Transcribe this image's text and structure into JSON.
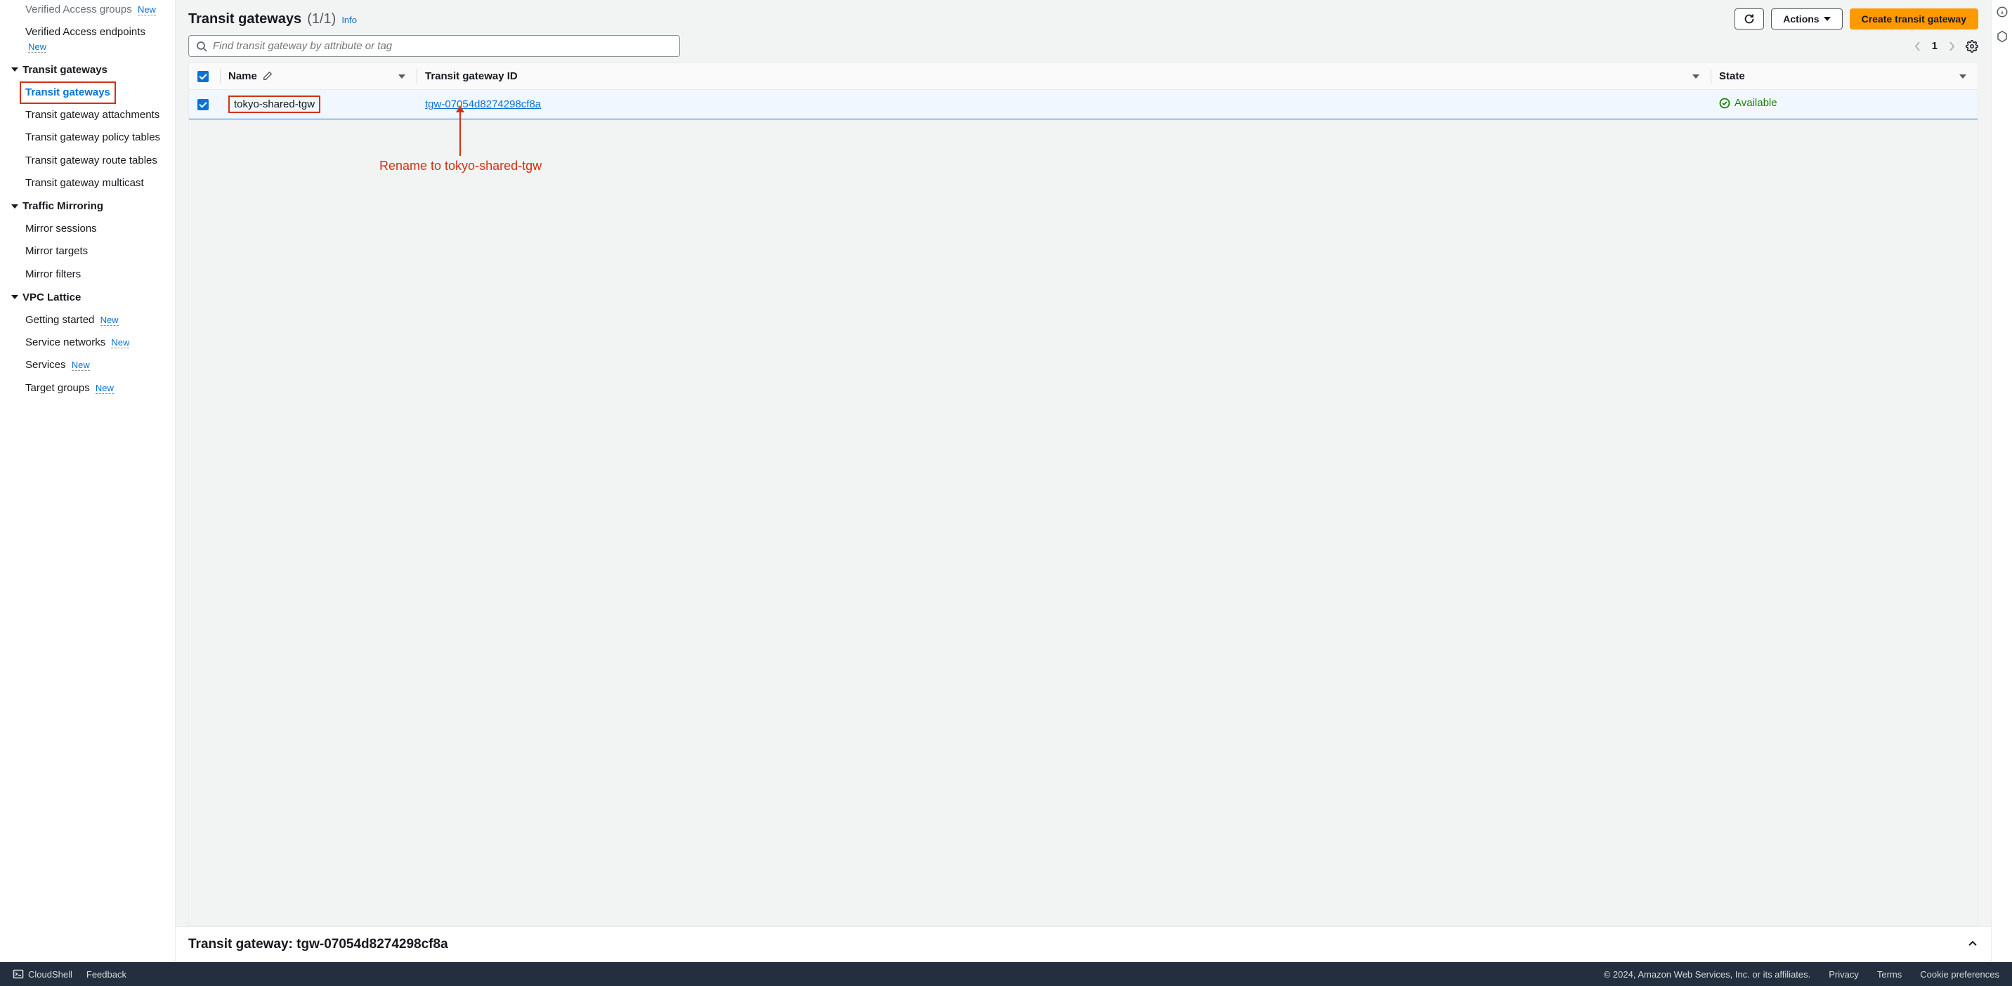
{
  "sidebar": {
    "sections": [
      {
        "items": [
          {
            "label": "Verified Access groups",
            "new": true
          },
          {
            "label": "Verified Access endpoints",
            "new": true
          }
        ]
      },
      {
        "header": "Transit gateways",
        "items": [
          {
            "label": "Transit gateways",
            "active": true
          },
          {
            "label": "Transit gateway attachments"
          },
          {
            "label": "Transit gateway policy tables"
          },
          {
            "label": "Transit gateway route tables"
          },
          {
            "label": "Transit gateway multicast"
          }
        ]
      },
      {
        "header": "Traffic Mirroring",
        "items": [
          {
            "label": "Mirror sessions"
          },
          {
            "label": "Mirror targets"
          },
          {
            "label": "Mirror filters"
          }
        ]
      },
      {
        "header": "VPC Lattice",
        "items": [
          {
            "label": "Getting started",
            "new": true
          },
          {
            "label": "Service networks",
            "new": true
          },
          {
            "label": "Services",
            "new": true
          },
          {
            "label": "Target groups",
            "new": true
          }
        ]
      }
    ],
    "new_badge": "New"
  },
  "header": {
    "title": "Transit gateways",
    "count": "(1/1)",
    "info": "Info",
    "refresh": "Refresh",
    "actions": "Actions",
    "create": "Create transit gateway"
  },
  "search": {
    "placeholder": "Find transit gateway by attribute or tag"
  },
  "pager": {
    "page": "1"
  },
  "table": {
    "columns": {
      "name": "Name",
      "tgw_id": "Transit gateway ID",
      "state": "State"
    },
    "rows": [
      {
        "name": "tokyo-shared-tgw",
        "tgw_id": "tgw-07054d8274298cf8a",
        "state": "Available"
      }
    ]
  },
  "annotation": {
    "text": "Rename to tokyo-shared-tgw"
  },
  "detail": {
    "title_prefix": "Transit gateway: ",
    "title_id": "tgw-07054d8274298cf8a"
  },
  "footer": {
    "cloudshell": "CloudShell",
    "feedback": "Feedback",
    "copyright": "© 2024, Amazon Web Services, Inc. or its affiliates.",
    "privacy": "Privacy",
    "terms": "Terms",
    "cookies": "Cookie preferences"
  }
}
